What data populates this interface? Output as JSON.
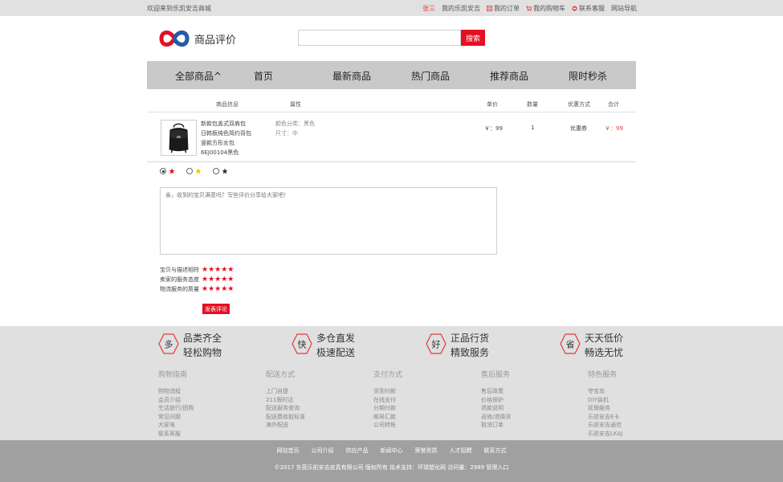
{
  "topbar": {
    "welcome": "欢迎来到乐凯安吉商城",
    "user": "张三",
    "my_site": "我的乐凯安吉",
    "my_orders": "我的订单",
    "my_cart": "我的购物车",
    "contact": "联系客服",
    "site_nav": "网站导航"
  },
  "header": {
    "page_title": "商品评价",
    "search_placeholder": "",
    "search_button": "搜索"
  },
  "nav": {
    "items": [
      "全部商品^",
      "首页",
      "最新商品",
      "热门商品",
      "推荐商品",
      "限时秒杀"
    ]
  },
  "table": {
    "headers": [
      "商品信息",
      "属性",
      "单价",
      "数量",
      "优惠方式",
      "合计"
    ]
  },
  "product": {
    "name_lines": [
      "新款包盖式双肩包",
      "日韩板纯色简约背包",
      "竖款方形女包",
      "6EJ00104黑色"
    ],
    "attr_color": "颜色分类：黑色",
    "attr_size": "尺寸：中",
    "price": "￥：99",
    "qty": "1",
    "discount": "优惠券",
    "total": "￥：99"
  },
  "review": {
    "placeholder": "亲，收到的宝贝满意吗？写些评价分享给大家吧！",
    "scores": [
      {
        "label": "宝贝与描述相符",
        "stars": "★★★★★"
      },
      {
        "label": "卖家的服务态度",
        "stars": "★★★★★"
      },
      {
        "label": "物流服务的质量",
        "stars": "★★★★★"
      }
    ],
    "submit": "发表评论"
  },
  "features": [
    {
      "icon": "多",
      "line1": "品类齐全",
      "line2": "轻松购物"
    },
    {
      "icon": "快",
      "line1": "多仓直发",
      "line2": "极速配送"
    },
    {
      "icon": "好",
      "line1": "正品行货",
      "line2": "精致服务"
    },
    {
      "icon": "省",
      "line1": "天天低价",
      "line2": "畅选无忧"
    }
  ],
  "footer_cols": [
    {
      "title": "购物指南",
      "items": [
        "购物流程",
        "会员介绍",
        "生活旅行/团购",
        "常见问题",
        "大家电",
        "联系客服"
      ]
    },
    {
      "title": "配送方式",
      "items": [
        "上门自提",
        "211限时达",
        "配送服务查询",
        "配送费收取标准",
        "海外配送"
      ]
    },
    {
      "title": "支付方式",
      "items": [
        "货到付款",
        "在线支付",
        "分期付款",
        "邮局汇款",
        "公司转帐"
      ]
    },
    {
      "title": "售后服务",
      "items": [
        "售后政策",
        "价格保护",
        "退款说明",
        "返修/退换货",
        "取消订单"
      ]
    },
    {
      "title": "特色服务",
      "items": [
        "夺宝岛",
        "DIY装机",
        "延保服务",
        "乐凯安吉E卡",
        "乐凯安吉通信",
        "乐凯安吉LKAJ"
      ]
    }
  ],
  "bottom": {
    "links": [
      "网站首页",
      "公司介绍",
      "供应产品",
      "新闻中心",
      "荣誉资质",
      "人才招聘",
      "联系方式"
    ],
    "copyright": "©2017 东莞乐凯安吉皮具有限公司 版权所有  技术支持：环球塑化网  访问量：2989     管理入口"
  },
  "colors": {
    "accent": "#e50f24",
    "nav_bg": "#c9c9c9",
    "footer_bg": "#e0e0e0",
    "bottom_bg": "#a0a0a0"
  }
}
